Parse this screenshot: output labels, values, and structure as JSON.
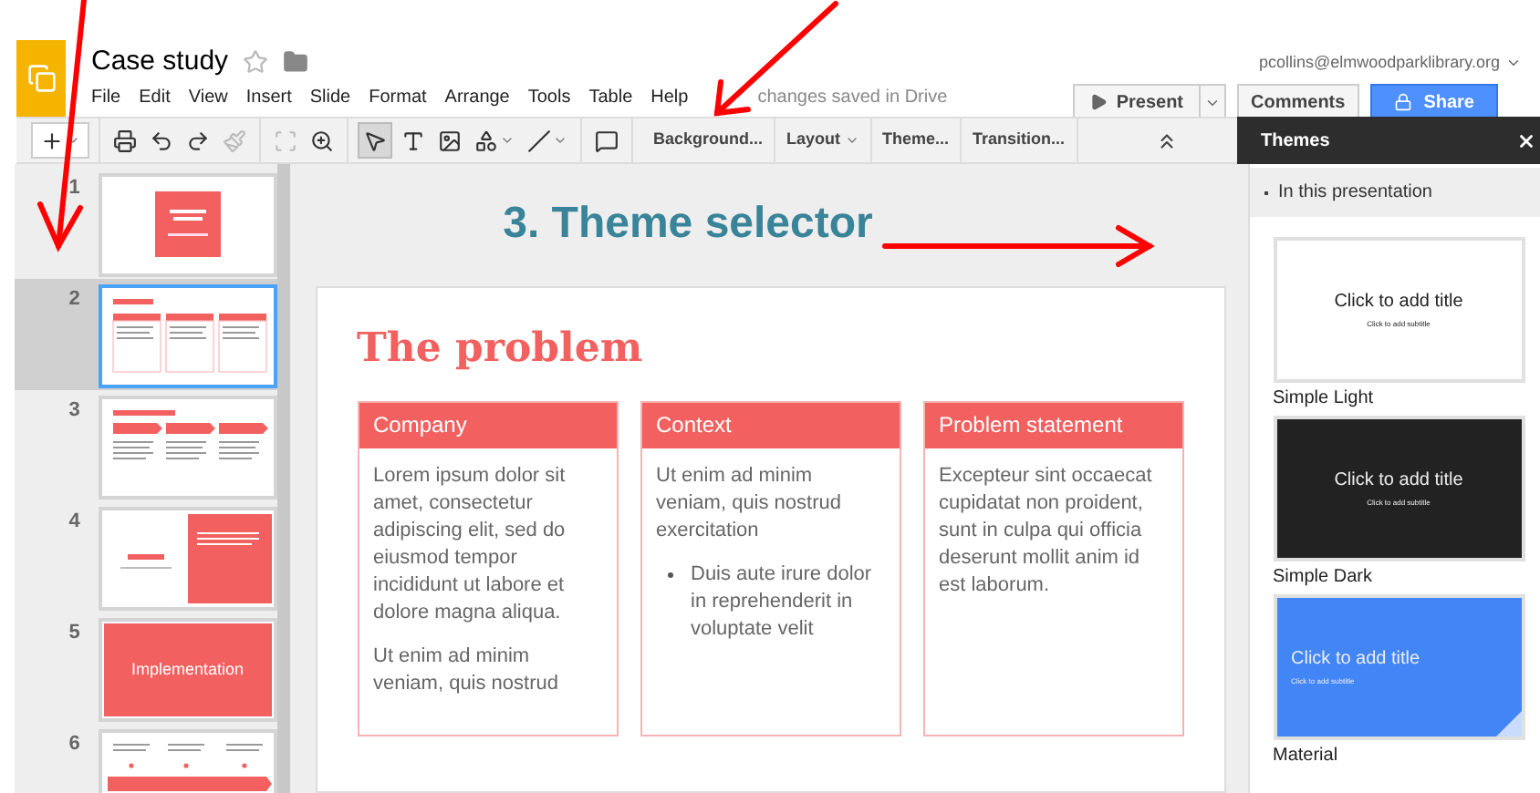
{
  "header": {
    "title": "Case study",
    "starred": false,
    "menu": [
      "File",
      "Edit",
      "View",
      "Insert",
      "Slide",
      "Format",
      "Arrange",
      "Tools",
      "Table",
      "Help"
    ],
    "save_status": "changes saved in Drive",
    "account": "pcollins@elmwoodparklibrary.org",
    "buttons": [
      {
        "kind": "present",
        "label": "Present"
      },
      {
        "kind": "plain",
        "label": "Comments"
      },
      {
        "kind": "share",
        "label": "Share"
      }
    ]
  },
  "toolbar": {
    "groups": [
      [
        {
          "kind": "new",
          "selected": false,
          "disabled": false,
          "dropdown": true
        }
      ],
      [
        {
          "kind": "print",
          "selected": false,
          "disabled": false,
          "dropdown": false
        },
        {
          "kind": "undo",
          "selected": false,
          "disabled": false,
          "dropdown": false
        },
        {
          "kind": "redo",
          "selected": false,
          "disabled": false,
          "dropdown": false
        },
        {
          "kind": "paint-format",
          "selected": false,
          "disabled": true,
          "dropdown": false
        }
      ],
      [
        {
          "kind": "fit",
          "selected": false,
          "disabled": true,
          "dropdown": false
        },
        {
          "kind": "zoom",
          "selected": false,
          "disabled": false,
          "dropdown": false
        }
      ],
      [
        {
          "kind": "select",
          "selected": true,
          "disabled": false,
          "dropdown": false
        },
        {
          "kind": "textbox",
          "selected": false,
          "disabled": false,
          "dropdown": false
        },
        {
          "kind": "image",
          "selected": false,
          "disabled": false,
          "dropdown": false
        },
        {
          "kind": "shape",
          "selected": false,
          "disabled": false,
          "dropdown": true
        },
        {
          "kind": "line",
          "selected": false,
          "disabled": false,
          "dropdown": true
        }
      ],
      [
        {
          "kind": "comment",
          "selected": false,
          "disabled": false,
          "dropdown": false
        }
      ]
    ],
    "text_buttons": [
      {
        "label": "Background...",
        "dropdown": false
      },
      {
        "label": "Layout",
        "dropdown": true
      },
      {
        "label": "Theme...",
        "dropdown": false
      },
      {
        "label": "Transition...",
        "dropdown": false
      }
    ]
  },
  "filmstrip": [
    {
      "number": "1",
      "selected": false,
      "kind": "title"
    },
    {
      "number": "2",
      "selected": true,
      "kind": "columns"
    },
    {
      "number": "3",
      "selected": false,
      "kind": "chevrons"
    },
    {
      "number": "4",
      "selected": false,
      "kind": "split"
    },
    {
      "number": "5",
      "selected": false,
      "kind": "section",
      "text": "Implementation"
    },
    {
      "number": "6",
      "selected": false,
      "kind": "timeline"
    }
  ],
  "annotation": "3. Theme selector",
  "slide": {
    "title": "The problem",
    "columns": [
      {
        "heading": "Company",
        "paragraphs": [
          {
            "text": "Lorem ipsum dolor sit amet, consectetur adipiscing elit, sed do eiusmod tempor incididunt ut labore et dolore magna aliqua.",
            "bullet": false
          },
          {
            "text": "Ut enim ad minim veniam, quis nostrud",
            "bullet": false
          }
        ]
      },
      {
        "heading": "Context",
        "paragraphs": [
          {
            "text": "Ut enim ad minim veniam, quis nostrud exercitation",
            "bullet": false
          },
          {
            "text": "Duis aute irure dolor in reprehenderit in voluptate velit",
            "bullet": true
          }
        ]
      },
      {
        "heading": "Problem statement",
        "paragraphs": [
          {
            "text": "Excepteur sint occaecat cupidatat non proident, sunt in culpa qui officia deserunt mollit anim id est laborum.",
            "bullet": false
          }
        ]
      }
    ]
  },
  "themes_panel": {
    "title": "Themes",
    "section": "In this presentation",
    "themes": [
      {
        "name": "Simple Light",
        "kind": "light",
        "title": "Click to add title",
        "subtitle": "Click to add subtitle"
      },
      {
        "name": "Simple Dark",
        "kind": "dark",
        "title": "Click to add title",
        "subtitle": "Click to add subtitle"
      },
      {
        "name": "Material",
        "kind": "material",
        "title": "Click to add title",
        "subtitle": "Click to add subtitle"
      }
    ]
  }
}
